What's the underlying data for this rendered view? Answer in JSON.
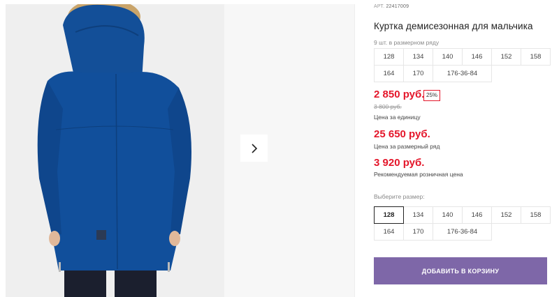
{
  "product": {
    "article_label": "АРТ.",
    "article_value": "22417009",
    "title": "Куртка демисезонная для мальчика",
    "row_count": "9 шт. в размерном ряду"
  },
  "size_row": [
    "128",
    "134",
    "140",
    "146",
    "152",
    "158",
    "164",
    "170",
    "176-36-84"
  ],
  "prices": {
    "unit_price": "2 850 руб.",
    "discount": "25%",
    "old_price": "3 800 руб.",
    "unit_label": "Цена за единицу",
    "row_price": "25 650 руб.",
    "row_label": "Цена за размерный ряд",
    "rrp_price": "3 920 руб.",
    "rrp_label": "Рекомендуемая розничная цена"
  },
  "size_select": {
    "label": "Выберите размер:",
    "options": [
      "128",
      "134",
      "140",
      "146",
      "152",
      "158",
      "164",
      "170",
      "176-36-84"
    ],
    "selected": "128"
  },
  "actions": {
    "add_to_cart": "ДОБАВИТЬ В КОРЗИНУ"
  },
  "colors": {
    "price_red": "#e4162a",
    "button_purple": "#7e67a8",
    "jacket_blue": "#114f9b"
  }
}
